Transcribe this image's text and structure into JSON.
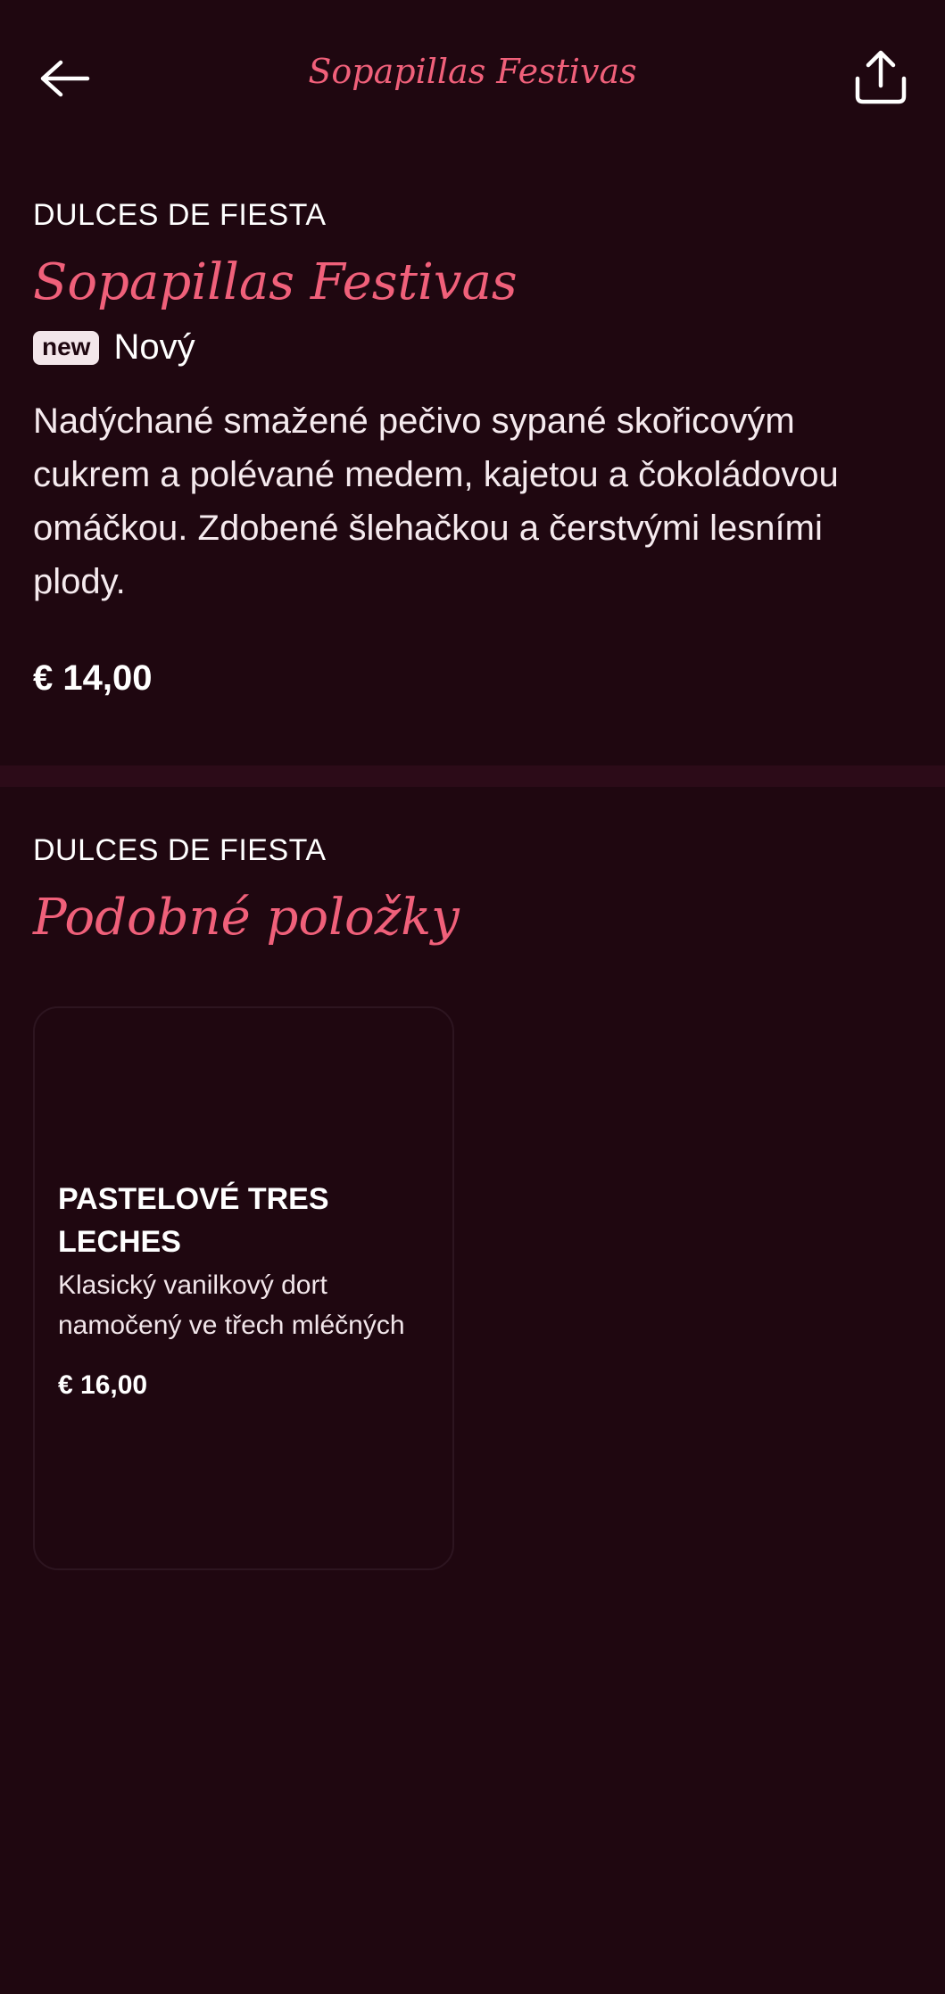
{
  "header": {
    "title": "Sopapillas Festivas",
    "back_icon": "arrow-left-icon",
    "share_icon": "share-icon"
  },
  "item": {
    "category": "DULCES DE FIESTA",
    "name": "Sopapillas Festivas",
    "badge": "new",
    "badge_label": "Nový",
    "description": "Nadýchané smažené pečivo sypané skořicovým cukrem a polévané medem, kajetou a čokoládovou omáčkou. Zdobené šlehačkou a čerstvými lesními plody.",
    "price": "€ 14,00"
  },
  "similar": {
    "category": "DULCES DE FIESTA",
    "title": "Podobné položky",
    "items": [
      {
        "name": "PASTELOVÉ TRES LECHES",
        "description": "Klasický vanilkový dort namočený ve třech mléčných",
        "price": "€ 16,00"
      }
    ]
  },
  "colors": {
    "background": "#1f0710",
    "accent": "#f0607a",
    "divider": "#2c0b18"
  }
}
